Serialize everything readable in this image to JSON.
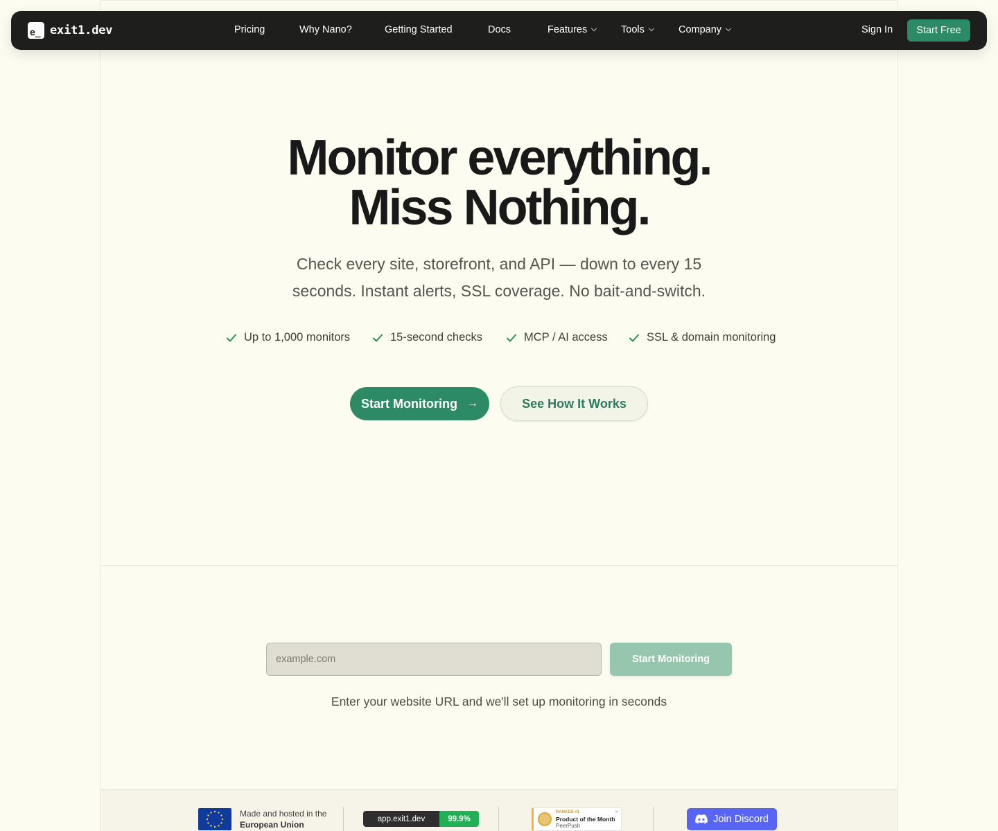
{
  "brand": {
    "logo_mark": "e_",
    "name": "exit1.dev"
  },
  "nav": {
    "links": [
      {
        "label": "Pricing",
        "dropdown": false
      },
      {
        "label": "Why Nano?",
        "dropdown": false
      },
      {
        "label": "Getting Started",
        "dropdown": false
      },
      {
        "label": "Docs",
        "dropdown": false
      },
      {
        "label": "Features",
        "dropdown": true
      },
      {
        "label": "Tools",
        "dropdown": true
      },
      {
        "label": "Company",
        "dropdown": true
      }
    ],
    "sign_in": "Sign In",
    "start_free": "Start Free"
  },
  "hero": {
    "title_line1": "Monitor everything.",
    "title_line2": "Miss Nothing.",
    "subtitle": "Check every site, storefront, and API — down to every 15 seconds. Instant alerts, SSL coverage. No bait-and-switch.",
    "features": [
      "Up to 1,000 monitors",
      "15-second checks",
      "MCP / AI access",
      "SSL & domain monitoring"
    ],
    "primary_cta": "Start Monitoring",
    "primary_cta_icon": "arrow-right-icon",
    "secondary_cta": "See How It Works"
  },
  "url_form": {
    "placeholder": "example.com",
    "value": "",
    "button": "Start Monitoring",
    "hint": "Enter your website URL and we'll set up monitoring in seconds"
  },
  "footer": {
    "eu_line1": "Made and hosted in the",
    "eu_line2": "European Union",
    "status_host": "app.exit1.dev",
    "status_uptime": "99.9%",
    "peer_rank": "RANKED #1",
    "peer_title": "Product of the Month",
    "peer_source": "PeerPush",
    "discord": "Join Discord"
  },
  "colors": {
    "accent": "#2d8a67",
    "background": "#fdfcf1",
    "nav_bg": "#1e1f1c",
    "discord": "#5865f2",
    "status_green": "#22b056"
  }
}
